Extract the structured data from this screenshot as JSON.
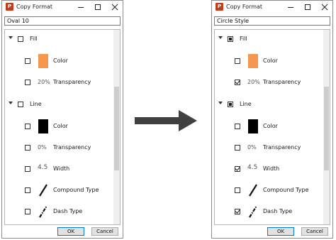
{
  "colors": {
    "fill_swatch": "#f5974e",
    "line_swatch": "#000000",
    "arrow": "#404040",
    "app_icon": "#c43e1c"
  },
  "windows": [
    {
      "title": "Copy Format",
      "name_value": "Oval 10",
      "controls": {
        "minimize": "minimize-icon",
        "maximize": "maximize-icon",
        "close": "close-icon"
      },
      "groups": [
        {
          "label": "Fill",
          "state": "unchecked",
          "items": [
            {
              "label": "Color",
              "checked": false,
              "preview": "",
              "preview_type": "swatch-orange"
            },
            {
              "label": "Transparency",
              "checked": false,
              "preview": "20%",
              "preview_type": "text"
            }
          ]
        },
        {
          "label": "Line",
          "state": "unchecked",
          "items": [
            {
              "label": "Color",
              "checked": false,
              "preview": "",
              "preview_type": "swatch-black"
            },
            {
              "label": "Transparency",
              "checked": false,
              "preview": "0%",
              "preview_type": "text"
            },
            {
              "label": "Width",
              "checked": false,
              "preview": "4.5",
              "preview_type": "text-big"
            },
            {
              "label": "Compound Type",
              "checked": false,
              "preview": "",
              "preview_type": "compound-line-icon"
            },
            {
              "label": "Dash Type",
              "checked": false,
              "preview": "",
              "preview_type": "dash-line-icon"
            }
          ]
        }
      ],
      "ok_label": "OK",
      "cancel_label": "Cancel"
    },
    {
      "title": "Copy Format",
      "name_value": "Circle Style",
      "controls": {
        "minimize": "minimize-icon",
        "maximize": "maximize-icon",
        "close": "close-icon"
      },
      "groups": [
        {
          "label": "Fill",
          "state": "indeterminate",
          "items": [
            {
              "label": "Color",
              "checked": false,
              "preview": "",
              "preview_type": "swatch-orange"
            },
            {
              "label": "Transparency",
              "checked": true,
              "preview": "20%",
              "preview_type": "text"
            }
          ]
        },
        {
          "label": "Line",
          "state": "indeterminate",
          "items": [
            {
              "label": "Color",
              "checked": false,
              "preview": "",
              "preview_type": "swatch-black"
            },
            {
              "label": "Transparency",
              "checked": false,
              "preview": "0%",
              "preview_type": "text"
            },
            {
              "label": "Width",
              "checked": true,
              "preview": "4.5",
              "preview_type": "text-big"
            },
            {
              "label": "Compound Type",
              "checked": false,
              "preview": "",
              "preview_type": "compound-line-icon"
            },
            {
              "label": "Dash Type",
              "checked": true,
              "preview": "",
              "preview_type": "dash-line-icon"
            }
          ]
        }
      ],
      "ok_label": "OK",
      "cancel_label": "Cancel"
    }
  ]
}
